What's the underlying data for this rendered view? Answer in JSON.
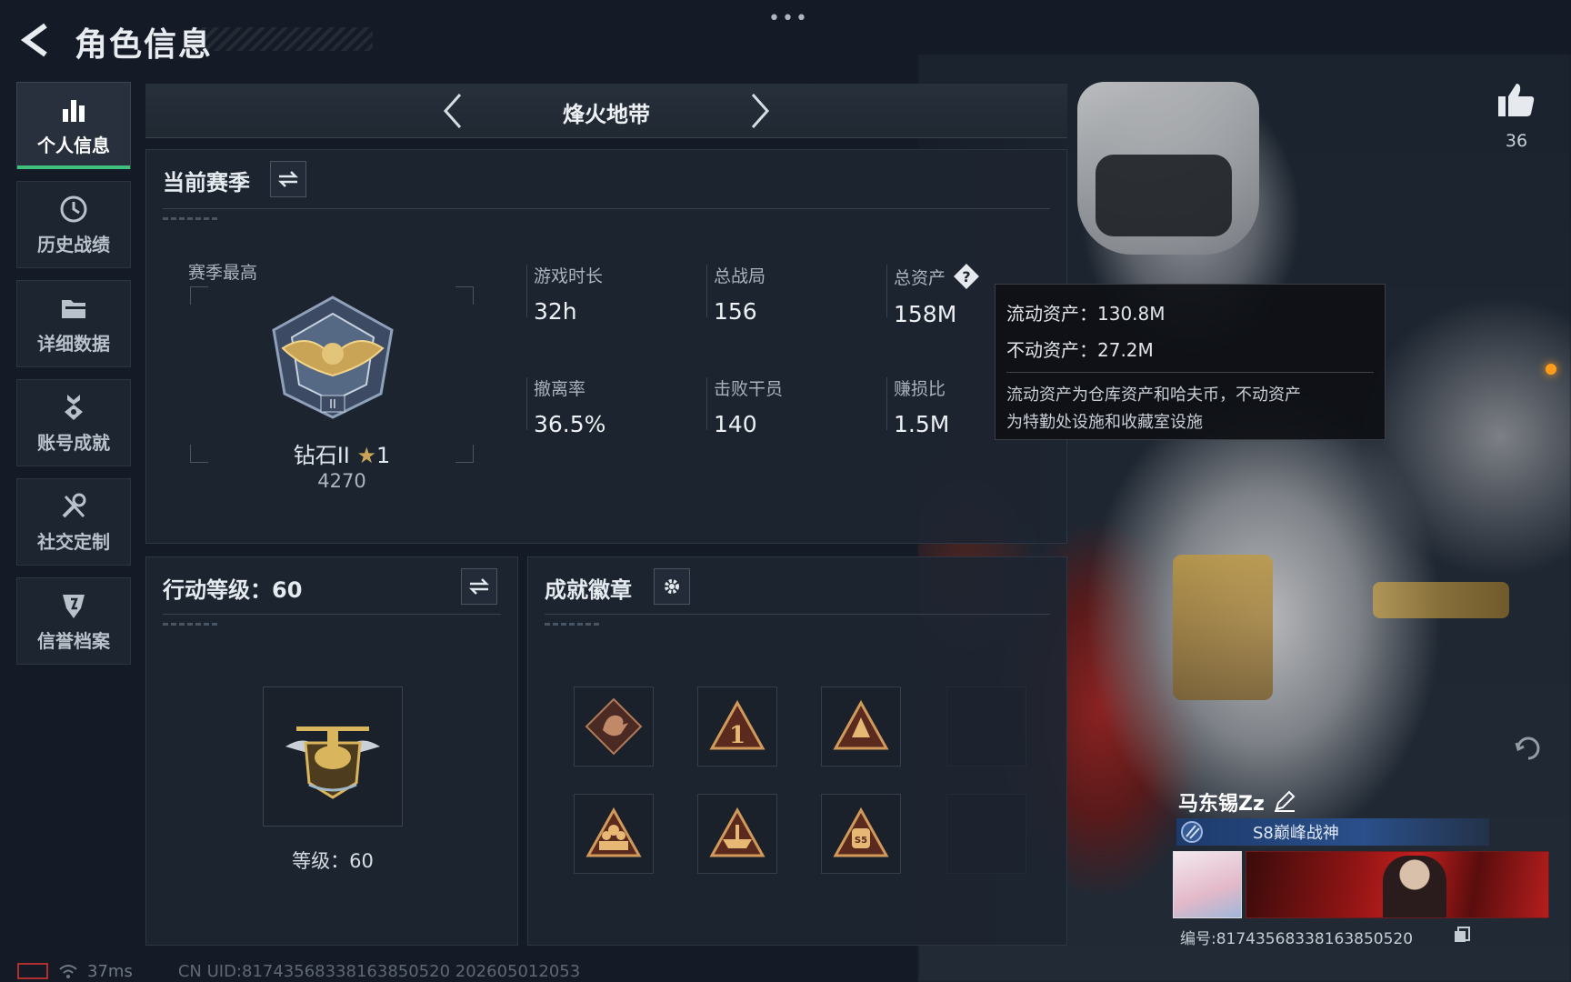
{
  "header": {
    "title": "角色信息",
    "menu_icon": "more-dots-icon"
  },
  "likes": {
    "count": "36"
  },
  "sidebar": {
    "items": [
      {
        "label": "个人信息",
        "icon": "bar-chart-icon",
        "active": true
      },
      {
        "label": "历史战绩",
        "icon": "history-clock-icon",
        "active": false
      },
      {
        "label": "详细数据",
        "icon": "folder-icon",
        "active": false
      },
      {
        "label": "账号成就",
        "icon": "achievement-medal-icon",
        "active": false
      },
      {
        "label": "社交定制",
        "icon": "tools-icon",
        "active": false
      },
      {
        "label": "信誉档案",
        "icon": "shield-badge-icon",
        "active": false
      }
    ]
  },
  "mode": {
    "title": "烽火地带"
  },
  "season": {
    "title": "当前赛季",
    "best_label": "赛季最高",
    "rank_name": "钻石II",
    "rank_stars": "1",
    "rank_score": "4270",
    "stats": [
      {
        "label": "游戏时长",
        "value": "32h"
      },
      {
        "label": "总战局",
        "value": "156"
      },
      {
        "label": "总资产",
        "value": "158M"
      },
      {
        "label": "撤离率",
        "value": "36.5%"
      },
      {
        "label": "击败干员",
        "value": "140"
      },
      {
        "label": "赚损比",
        "value": "1.5M"
      }
    ]
  },
  "tooltip": {
    "liquid": "流动资产：130.8M",
    "fixed": "不动资产：27.2M",
    "desc_line1": "流动资产为仓库资产和哈夫币，不动资产",
    "desc_line2": "为特勤处设施和收藏室设施"
  },
  "level": {
    "title": "行动等级：60",
    "text": "等级：60"
  },
  "badges": {
    "title": "成就徽章",
    "count_visible": 6
  },
  "player": {
    "name": "马东锡Zz",
    "title": "S8巅峰战神",
    "id_text": "编号:81743568338163850520"
  },
  "footer": {
    "ping": "37ms",
    "uid": "CN UID:81743568338163850520  202605012053"
  },
  "colors": {
    "active_accent": "#3fc17d",
    "gold": "#c9a457",
    "panel_bg": "#1d2531"
  }
}
